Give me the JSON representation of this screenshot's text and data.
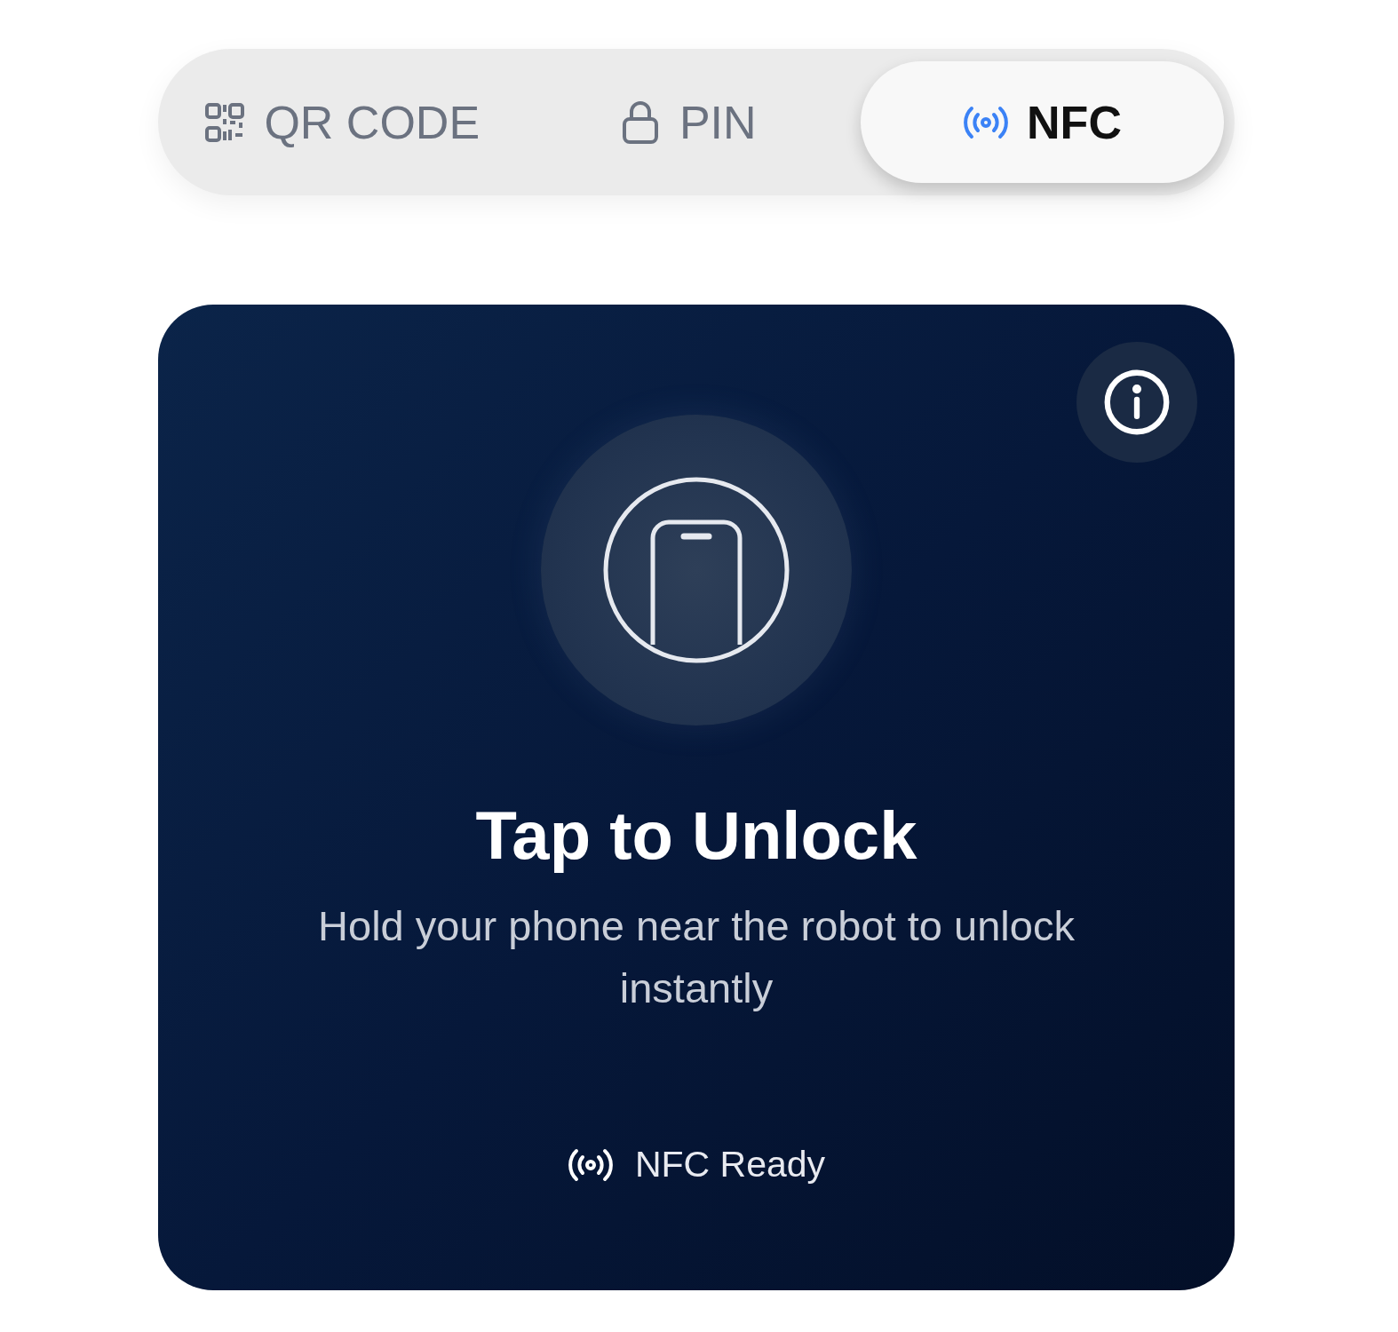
{
  "tabs": [
    {
      "label": "QR CODE",
      "kind": "qr",
      "selected": false
    },
    {
      "label": "PIN",
      "kind": "lock",
      "selected": false
    },
    {
      "label": "NFC",
      "kind": "nfc",
      "selected": true
    }
  ],
  "card": {
    "title": "Tap to Unlock",
    "description": "Hold your phone near the robot to unlock instantly",
    "status": "NFC Ready"
  }
}
